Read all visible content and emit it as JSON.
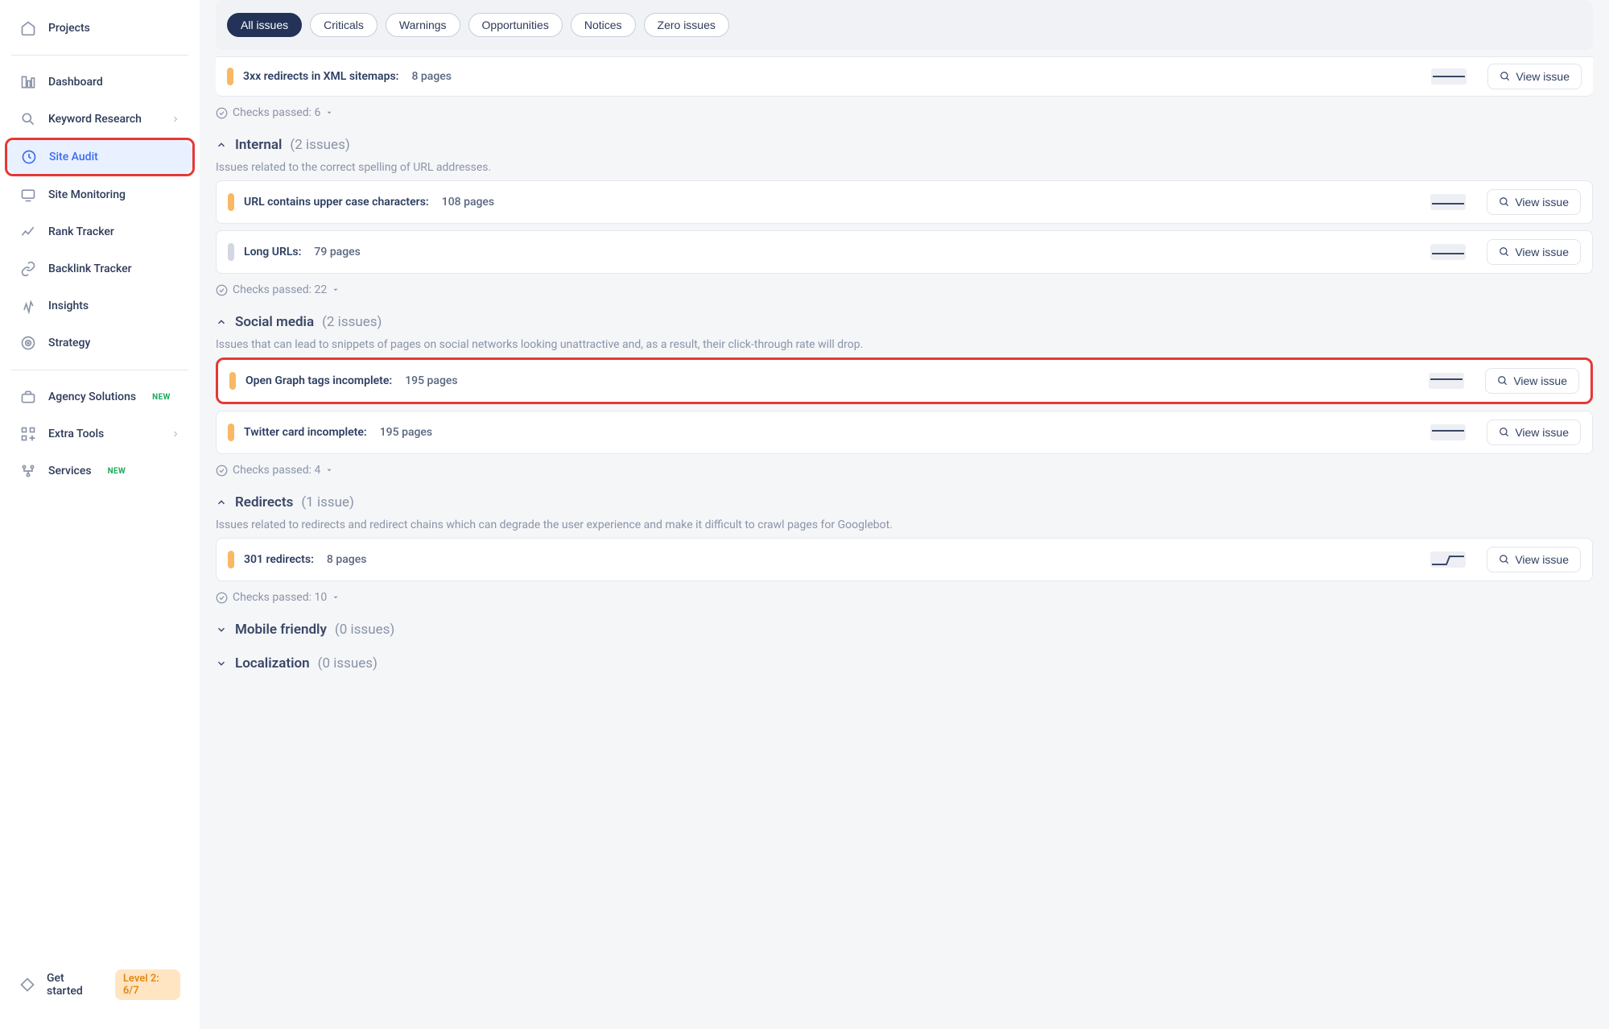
{
  "sidebar": {
    "projects_label": "Projects",
    "items": {
      "dashboard": "Dashboard",
      "keyword_research": "Keyword Research",
      "site_audit": "Site Audit",
      "site_monitoring": "Site Monitoring",
      "rank_tracker": "Rank Tracker",
      "backlink_tracker": "Backlink Tracker",
      "insights": "Insights",
      "strategy": "Strategy",
      "agency_solutions": "Agency Solutions",
      "extra_tools": "Extra Tools",
      "services": "Services"
    },
    "badge_new": "NEW",
    "get_started": "Get started",
    "level": "Level 2: 6/7"
  },
  "filters": {
    "all": "All issues",
    "criticals": "Criticals",
    "warnings": "Warnings",
    "opportunities": "Opportunities",
    "notices": "Notices",
    "zero": "Zero issues"
  },
  "truncated_issue": {
    "label": "3xx redirects in XML sitemaps:",
    "pages": "8 pages"
  },
  "view_issue_label": "View issue",
  "sections": {
    "top_checks_passed": "Checks passed: 6",
    "internal": {
      "title": "Internal",
      "count": "(2 issues)",
      "desc": "Issues related to the correct spelling of URL addresses.",
      "issues": [
        {
          "label": "URL contains upper case characters:",
          "pages": "108 pages",
          "sev": "warn"
        },
        {
          "label": "Long URLs:",
          "pages": "79 pages",
          "sev": "notice"
        }
      ],
      "checks_passed": "Checks passed: 22"
    },
    "social": {
      "title": "Social media",
      "count": "(2 issues)",
      "desc": "Issues that can lead to snippets of pages on social networks looking unattractive and, as a result, their click-through rate will drop.",
      "issues": [
        {
          "label": "Open Graph tags incomplete:",
          "pages": "195 pages",
          "sev": "warn"
        },
        {
          "label": "Twitter card incomplete:",
          "pages": "195 pages",
          "sev": "warn"
        }
      ],
      "checks_passed": "Checks passed: 4"
    },
    "redirects": {
      "title": "Redirects",
      "count": "(1 issue)",
      "desc": "Issues related to redirects and redirect chains which can degrade the user experience and make it difficult to crawl pages for Googlebot.",
      "issues": [
        {
          "label": "301 redirects:",
          "pages": "8 pages",
          "sev": "warn"
        }
      ],
      "checks_passed": "Checks passed: 10"
    },
    "mobile": {
      "title": "Mobile friendly",
      "count": "(0 issues)"
    },
    "localization": {
      "title": "Localization",
      "count": "(0 issues)"
    }
  }
}
